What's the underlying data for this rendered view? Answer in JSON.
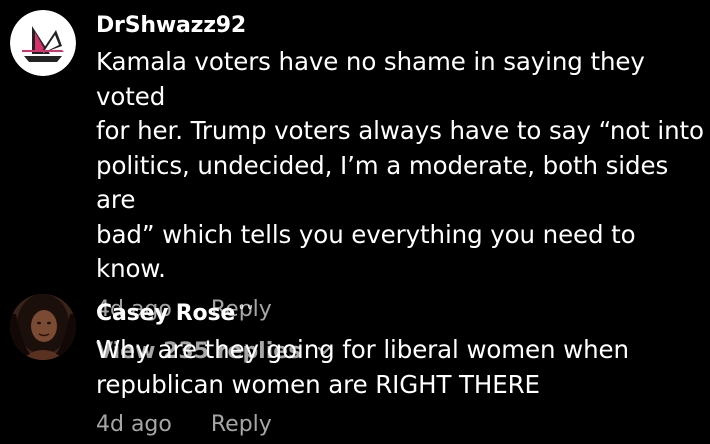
{
  "colors": {
    "background": "#000000",
    "text": "#ffffff",
    "muted": "#a6a6a6"
  },
  "comments": [
    {
      "username": "DrShwazz92",
      "avatar_icon": "sailboat-logo-avatar",
      "text_lines": [
        "Kamala voters have no shame in saying they voted",
        "for her. Trump voters always have to say “not into",
        "politics, undecided, I’m a moderate, both sides are",
        "bad” which tells you everything you need to know."
      ],
      "time": "4d ago",
      "reply_label": "Reply",
      "view_replies_label": "View 235 replies"
    },
    {
      "username": "Casey Rose",
      "username_glyph": "ᐡ ᐡ",
      "avatar_icon": "profile-photo-avatar",
      "text_lines": [
        "Why are they going for liberal women when",
        "republican women are RIGHT THERE"
      ],
      "time": "4d ago",
      "reply_label": "Reply"
    }
  ]
}
